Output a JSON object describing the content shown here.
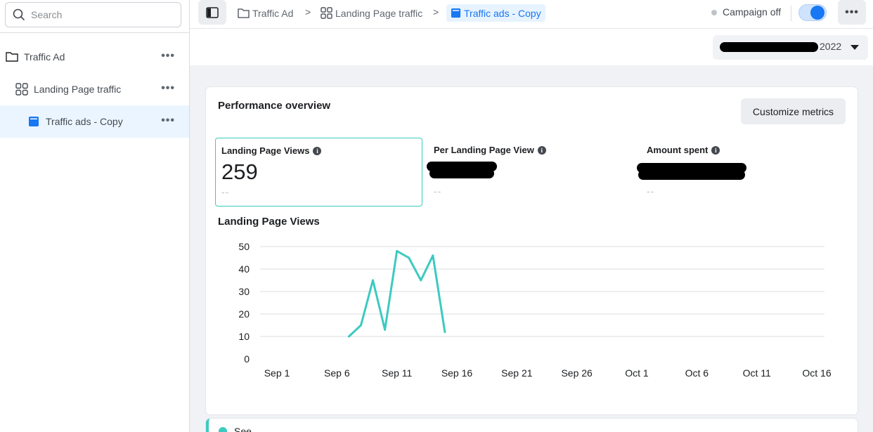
{
  "sidebar": {
    "search_placeholder": "Search",
    "items": [
      {
        "label": "Traffic Ad",
        "icon": "folder-icon"
      },
      {
        "label": "Landing Page traffic",
        "icon": "ad-set-grid-icon"
      },
      {
        "label": "Traffic ads - Copy",
        "icon": "ad-square-icon"
      }
    ],
    "more_label": "•••"
  },
  "breadcrumb": [
    {
      "label": "Traffic Ad",
      "icon": "folder-icon"
    },
    {
      "label": "Landing Page traffic",
      "icon": "ad-set-grid-icon"
    },
    {
      "label": "Traffic ads - Copy",
      "icon": "ad-square-icon"
    }
  ],
  "topbar": {
    "separator": ">",
    "campaign_status": "Campaign off",
    "toggle_on": true,
    "more_label": "•••"
  },
  "date_range": {
    "year": "2022"
  },
  "performance": {
    "title": "Performance overview",
    "customize_label": "Customize metrics",
    "metrics": [
      {
        "label": "Landing Page Views",
        "value": "259",
        "sub": "--"
      },
      {
        "label": "Per Landing Page View",
        "value": "",
        "sub": "--"
      },
      {
        "label": "Amount spent",
        "value": "",
        "sub": "--"
      }
    ],
    "info_glyph": "i"
  },
  "chart_data": {
    "type": "line",
    "title": "Landing Page Views",
    "xlabel": "",
    "ylabel": "",
    "ylim": [
      0,
      50
    ],
    "yticks": [
      0,
      10,
      20,
      30,
      40,
      50
    ],
    "xticks": [
      "Sep 1",
      "Sep 6",
      "Sep 11",
      "Sep 16",
      "Sep 21",
      "Sep 26",
      "Oct 1",
      "Oct 6",
      "Oct 11",
      "Oct 16"
    ],
    "series": [
      {
        "color": "#3ccac0",
        "x": [
          "Sep 7",
          "Sep 8",
          "Sep 9",
          "Sep 10",
          "Sep 11",
          "Sep 12",
          "Sep 13",
          "Sep 14",
          "Sep 15"
        ],
        "values": [
          10,
          15,
          35,
          13,
          48,
          45,
          35,
          46,
          12
        ]
      }
    ],
    "grid": true
  },
  "next_card": {
    "text": "See"
  }
}
